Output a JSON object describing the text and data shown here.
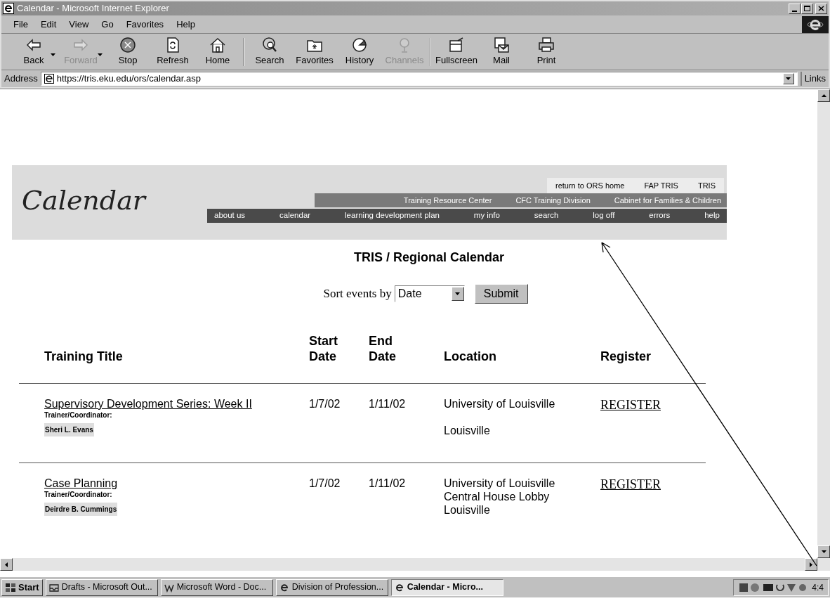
{
  "window": {
    "title": "Calendar - Microsoft Internet Explorer"
  },
  "menu": [
    "File",
    "Edit",
    "View",
    "Go",
    "Favorites",
    "Help"
  ],
  "toolbar": [
    {
      "kind": "back",
      "label": "Back",
      "disabled": false,
      "dropdown": true
    },
    {
      "kind": "forward",
      "label": "Forward",
      "disabled": true,
      "dropdown": true
    },
    {
      "kind": "stop",
      "label": "Stop",
      "disabled": false,
      "dropdown": false
    },
    {
      "kind": "refresh",
      "label": "Refresh",
      "disabled": false,
      "dropdown": false
    },
    {
      "kind": "home",
      "label": "Home",
      "disabled": false,
      "dropdown": false
    },
    {
      "kind": "search",
      "label": "Search",
      "disabled": false,
      "dropdown": false
    },
    {
      "kind": "favorites",
      "label": "Favorites",
      "disabled": false,
      "dropdown": false
    },
    {
      "kind": "history",
      "label": "History",
      "disabled": false,
      "dropdown": false
    },
    {
      "kind": "channels",
      "label": "Channels",
      "disabled": true,
      "dropdown": false
    },
    {
      "kind": "fullscreen",
      "label": "Fullscreen",
      "disabled": false,
      "dropdown": false
    },
    {
      "kind": "mail",
      "label": "Mail",
      "disabled": false,
      "dropdown": false
    },
    {
      "kind": "print",
      "label": "Print",
      "disabled": false,
      "dropdown": false
    }
  ],
  "address": {
    "label": "Address",
    "value": "https://tris.eku.edu/ors/calendar.asp",
    "links": "Links"
  },
  "page": {
    "logo": "Calendar",
    "top_links": [
      "return to ORS home",
      "FAP TRIS",
      "TRIS"
    ],
    "org_links": [
      "Training Resource Center",
      "CFC Training Division",
      "Cabinet for Families & Children"
    ],
    "nav": [
      "about us",
      "calendar",
      "learning development plan",
      "my info",
      "search",
      "log off",
      "errors",
      "help"
    ],
    "heading": "TRIS / Regional Calendar",
    "sort": {
      "label": "Sort events by",
      "value": "Date",
      "button": "Submit"
    },
    "columns": [
      [
        "Training Title"
      ],
      [
        "Start",
        "Date"
      ],
      [
        "End",
        "Date"
      ],
      [
        "Location"
      ],
      [
        "Register"
      ]
    ],
    "rows": [
      {
        "title": "Supervisory Development Series: Week II",
        "trainer_label": "Trainer/Coordinator:",
        "trainer": "Sheri L. Evans",
        "start": "1/7/02",
        "end": "1/11/02",
        "location": [
          "University of Louisville",
          "Louisville"
        ],
        "register": "REGISTER"
      },
      {
        "title": "Case Planning",
        "trainer_label": "Trainer/Coordinator:",
        "trainer": "Deirdre B. Cummings",
        "start": "1/7/02",
        "end": "1/11/02",
        "location": [
          "University of Louisville",
          "Central House Lobby",
          "Louisville"
        ],
        "register": "REGISTER"
      }
    ]
  },
  "taskbar": {
    "start": "Start",
    "tasks": [
      {
        "kind": "outlook",
        "label": "Drafts - Microsoft Out...",
        "selected": false
      },
      {
        "kind": "word",
        "label": "Microsoft Word - Doc...",
        "selected": false
      },
      {
        "kind": "ie",
        "label": "Division of Profession...",
        "selected": false
      },
      {
        "kind": "ie",
        "label": "Calendar - Micro...",
        "selected": true
      }
    ],
    "clock": "4:4"
  }
}
